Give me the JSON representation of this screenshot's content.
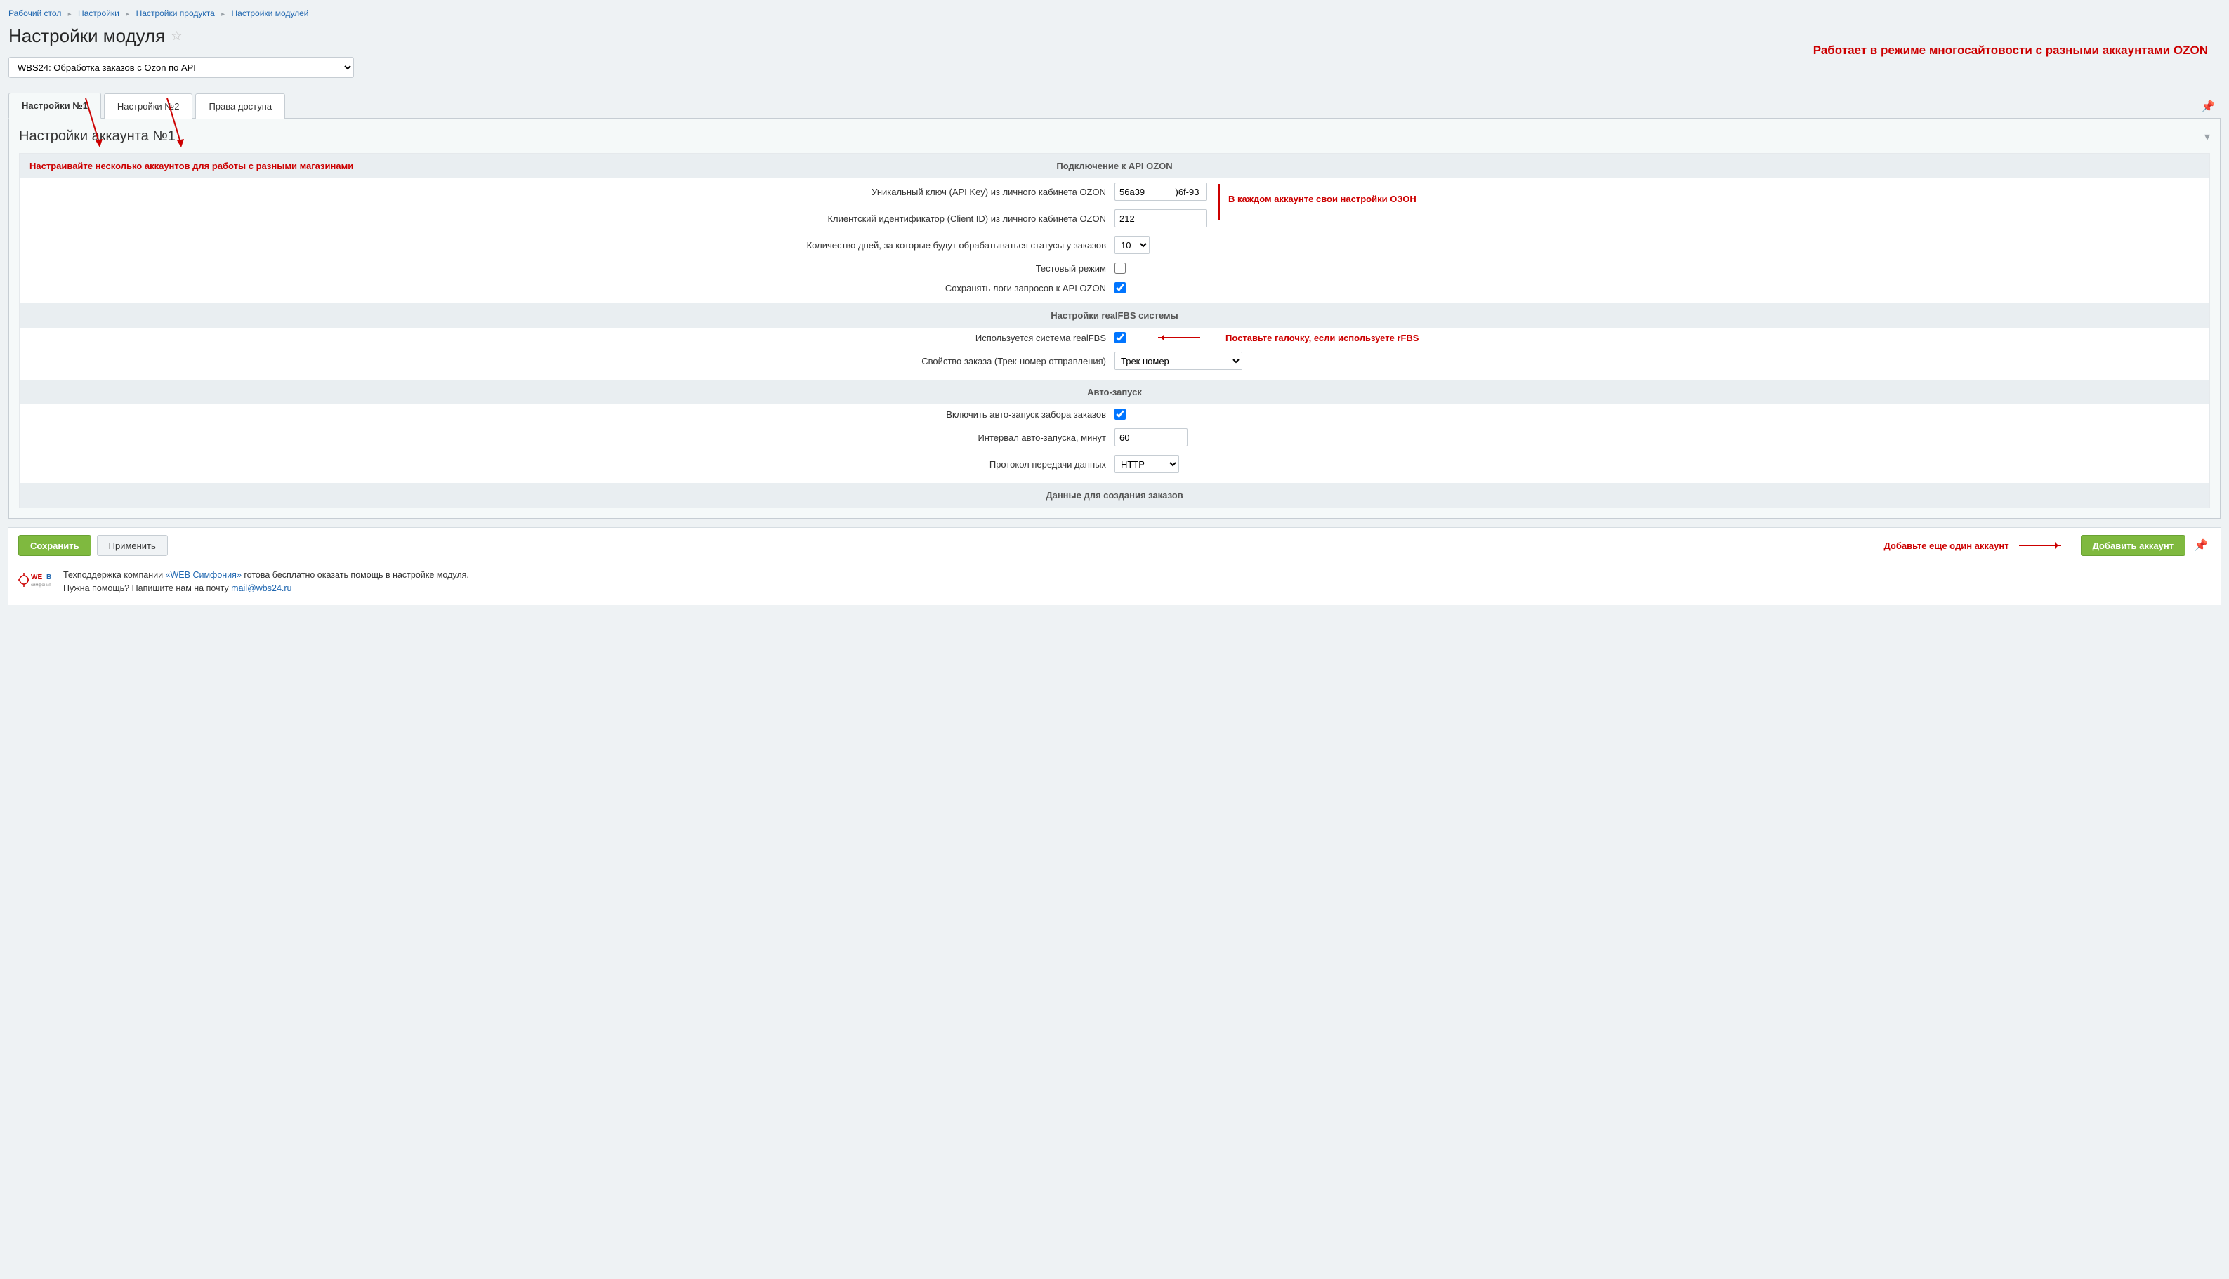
{
  "breadcrumbs": [
    "Рабочий стол",
    "Настройки",
    "Настройки продукта",
    "Настройки модулей"
  ],
  "page_title": "Настройки модуля",
  "banner": "Работает в режиме многосайтовости с разными аккаунтами OZON",
  "module_select": {
    "value": "WBS24: Обработка заказов с Ozon по API",
    "options": [
      "WBS24: Обработка заказов с Ozon по API"
    ]
  },
  "tabs": [
    {
      "label": "Настройки №1",
      "active": true
    },
    {
      "label": "Настройки №2",
      "active": false
    },
    {
      "label": "Права доступа",
      "active": false
    }
  ],
  "section_title": "Настройки аккаунта №1",
  "notes": {
    "multi_accounts": "Настраивайте несколько аккаунтов для работы с разными магазинами",
    "per_account": "В каждом аккаунте свои настройки ОЗОН",
    "rfbs": "Поставьте галочку, если используете rFBS",
    "add_account": "Добавьте еще один аккаунт"
  },
  "groups": {
    "api": {
      "heading": "Подключение к API OZON",
      "fields": {
        "api_key": {
          "label": "Уникальный ключ (API Key) из личного кабинета OZON",
          "value": "56a39            )6f-93"
        },
        "client_id": {
          "label": "Клиентский идентификатор (Client ID) из личного кабинета OZON",
          "value": "212"
        },
        "days": {
          "label": "Количество дней, за которые будут обрабатываться статусы у заказов",
          "value": "10",
          "options": [
            "10"
          ]
        },
        "test": {
          "label": "Тестовый режим",
          "checked": false
        },
        "logs": {
          "label": "Сохранять логи запросов к API OZON",
          "checked": true
        }
      }
    },
    "realfbs": {
      "heading": "Настройки realFBS системы",
      "fields": {
        "use_realfbs": {
          "label": "Используется система realFBS",
          "checked": true
        },
        "track_prop": {
          "label": "Свойство заказа (Трек-номер отправления)",
          "value": "Трек номер",
          "options": [
            "Трек номер"
          ]
        }
      }
    },
    "auto": {
      "heading": "Авто-запуск",
      "fields": {
        "enable": {
          "label": "Включить авто-запуск забора заказов",
          "checked": true
        },
        "interval": {
          "label": "Интервал авто-запуска, минут",
          "value": "60"
        },
        "protocol": {
          "label": "Протокол передачи данных",
          "value": "HTTP",
          "options": [
            "HTTP"
          ]
        }
      }
    },
    "orders": {
      "heading": "Данные для создания заказов"
    }
  },
  "footer": {
    "save": "Сохранить",
    "apply": "Применить",
    "add_account": "Добавить аккаунт"
  },
  "support": {
    "line1_a": "Техподдержка компании ",
    "line1_link": "«WEB Симфония»",
    "line1_b": " готова бесплатно оказать помощь в настройке модуля.",
    "line2_a": "Нужна помощь? Напишите нам на почту ",
    "line2_link": "mail@wbs24.ru"
  }
}
